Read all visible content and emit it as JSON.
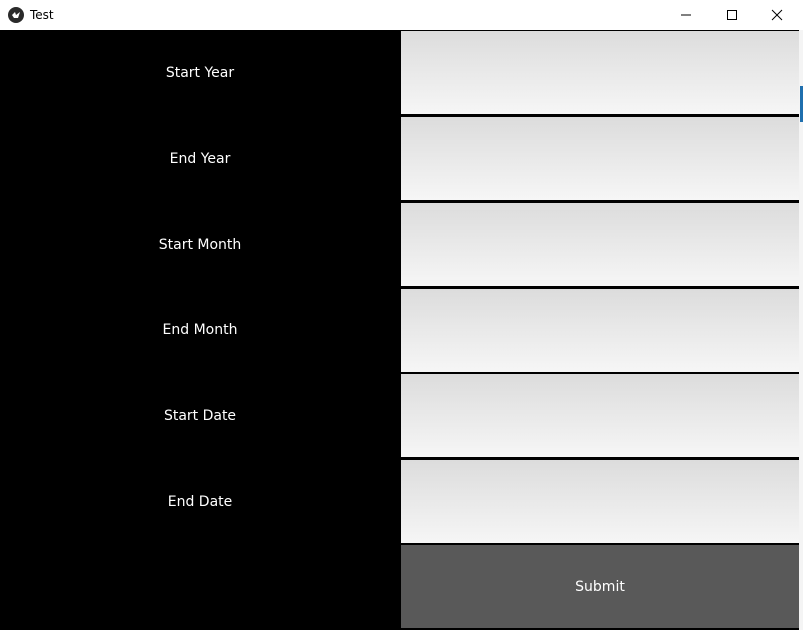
{
  "window": {
    "title": "Test"
  },
  "form": {
    "labels": {
      "start_year": "Start Year",
      "end_year": "End Year",
      "start_month": "Start Month",
      "end_month": "End Month",
      "start_date": "Start Date",
      "end_date": "End Date"
    },
    "values": {
      "start_year": "",
      "end_year": "",
      "start_month": "",
      "end_month": "",
      "start_date": "",
      "end_date": ""
    },
    "submit_label": "Submit"
  },
  "icons": {
    "app": "app-icon",
    "minimize": "minimize-icon",
    "maximize": "maximize-icon",
    "close": "close-icon"
  },
  "colors": {
    "background": "#000000",
    "label_text": "#ffffff",
    "field_top": "#dcdcdc",
    "field_bottom": "#f6f6f6",
    "submit_bg": "#595959",
    "submit_text": "#ffffff"
  }
}
